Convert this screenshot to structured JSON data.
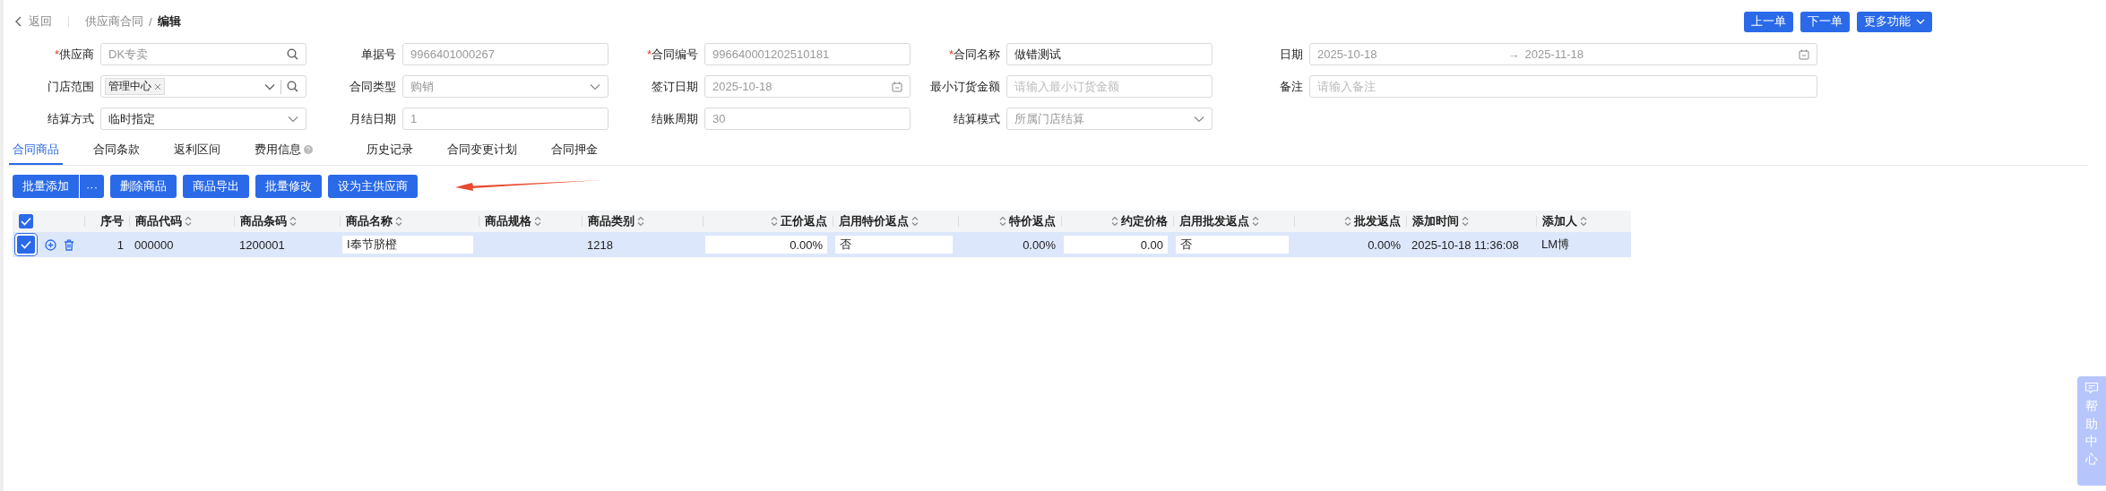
{
  "header": {
    "back": "返回",
    "breadcrumb": [
      "供应商合同",
      "编辑"
    ],
    "separator": "/"
  },
  "nav_buttons": [
    {
      "label": "上一单",
      "kind": "plain"
    },
    {
      "label": "下一单",
      "kind": "plain"
    },
    {
      "label": "更多功能",
      "kind": "dropdown"
    }
  ],
  "form": [
    {
      "label": "供应商",
      "required_mark": "*",
      "kind": "search",
      "value": "DK专卖",
      "disabled": true
    },
    {
      "label": "单据号",
      "kind": "text",
      "value": "9966401000267",
      "disabled": true
    },
    {
      "label": "合同编号",
      "required_mark": "*",
      "kind": "text",
      "value": "996640001202510181",
      "disabled": true
    },
    {
      "label": "合同名称",
      "required_mark": "*",
      "kind": "text",
      "value": "做错测试",
      "disabled": false
    },
    {
      "label": "日期",
      "kind": "daterange",
      "value": "2025-10-18",
      "value_end": "2025-11-18",
      "separator": "→",
      "disabled": true
    },
    {
      "label": "门店范围",
      "kind": "tags",
      "tags": [
        "管理中心"
      ]
    },
    {
      "label": "合同类型",
      "kind": "select",
      "value": "购销",
      "disabled": true
    },
    {
      "label": "签订日期",
      "kind": "date",
      "value": "2025-10-18",
      "disabled": true
    },
    {
      "label": "最小订货金额",
      "kind": "text",
      "placeholder": "请输入最小订货金额"
    },
    {
      "label": "备注",
      "kind": "text",
      "placeholder": "请输入备注"
    },
    {
      "label": "结算方式",
      "kind": "select",
      "value": "临时指定",
      "disabled": false
    },
    {
      "label": "月结日期",
      "kind": "text",
      "value": "1",
      "disabled": true
    },
    {
      "label": "结账周期",
      "kind": "text",
      "value": "30",
      "disabled": true
    },
    {
      "label": "结算模式",
      "kind": "select",
      "value": "所属门店结算",
      "disabled": true
    }
  ],
  "tabs": [
    {
      "label": "合同商品",
      "selected": true,
      "help": false
    },
    {
      "label": "合同条款",
      "selected": false,
      "help": false
    },
    {
      "label": "返利区间",
      "selected": false,
      "help": false
    },
    {
      "label": "费用信息",
      "selected": false,
      "help": true
    },
    {
      "label": "历史记录",
      "selected": false,
      "help": false
    },
    {
      "label": "合同变更计划",
      "selected": false,
      "help": false
    },
    {
      "label": "合同押金",
      "selected": false,
      "help": false
    }
  ],
  "toolbar": [
    {
      "label": "批量添加",
      "more": "···"
    },
    {
      "label": "删除商品"
    },
    {
      "label": "商品导出"
    },
    {
      "label": "批量修改"
    },
    {
      "label": "设为主供应商"
    }
  ],
  "table": {
    "all_selected": true,
    "columns": [
      {
        "label": "序号",
        "sortable": false
      },
      {
        "label": "商品代码",
        "sortable": true
      },
      {
        "label": "商品条码",
        "sortable": true
      },
      {
        "label": "商品名称",
        "sortable": true
      },
      {
        "label": "商品规格",
        "sortable": true
      },
      {
        "label": "商品类别",
        "sortable": true
      },
      {
        "label": "正价返点",
        "sortable": true
      },
      {
        "label": "启用特价返点",
        "sortable": true
      },
      {
        "label": "特价返点",
        "sortable": true
      },
      {
        "label": "约定价格",
        "sortable": true
      },
      {
        "label": "启用批发返点",
        "sortable": true
      },
      {
        "label": "批发返点",
        "sortable": true
      },
      {
        "label": "添加时间",
        "sortable": true
      },
      {
        "label": "添加人",
        "sortable": true
      }
    ],
    "rows": [
      {
        "selected": true,
        "cells": [
          {
            "kind": "text",
            "value": "1"
          },
          {
            "kind": "text",
            "value": "000000"
          },
          {
            "kind": "text",
            "value": "1200001"
          },
          {
            "kind": "input",
            "value": "I奉节脐橙"
          },
          {
            "kind": "text"
          },
          {
            "kind": "text",
            "value": "1218"
          },
          {
            "kind": "input",
            "value": "0.00%"
          },
          {
            "kind": "input",
            "value": "否"
          },
          {
            "kind": "text",
            "value": "0.00%"
          },
          {
            "kind": "input",
            "value": "0.00"
          },
          {
            "kind": "input",
            "value": "否"
          },
          {
            "kind": "text",
            "value": "0.00%"
          },
          {
            "kind": "text",
            "value": "2025-10-18 11:36:08"
          },
          {
            "kind": "text",
            "value": "LM博"
          }
        ]
      }
    ]
  },
  "help_center": "帮助中心"
}
